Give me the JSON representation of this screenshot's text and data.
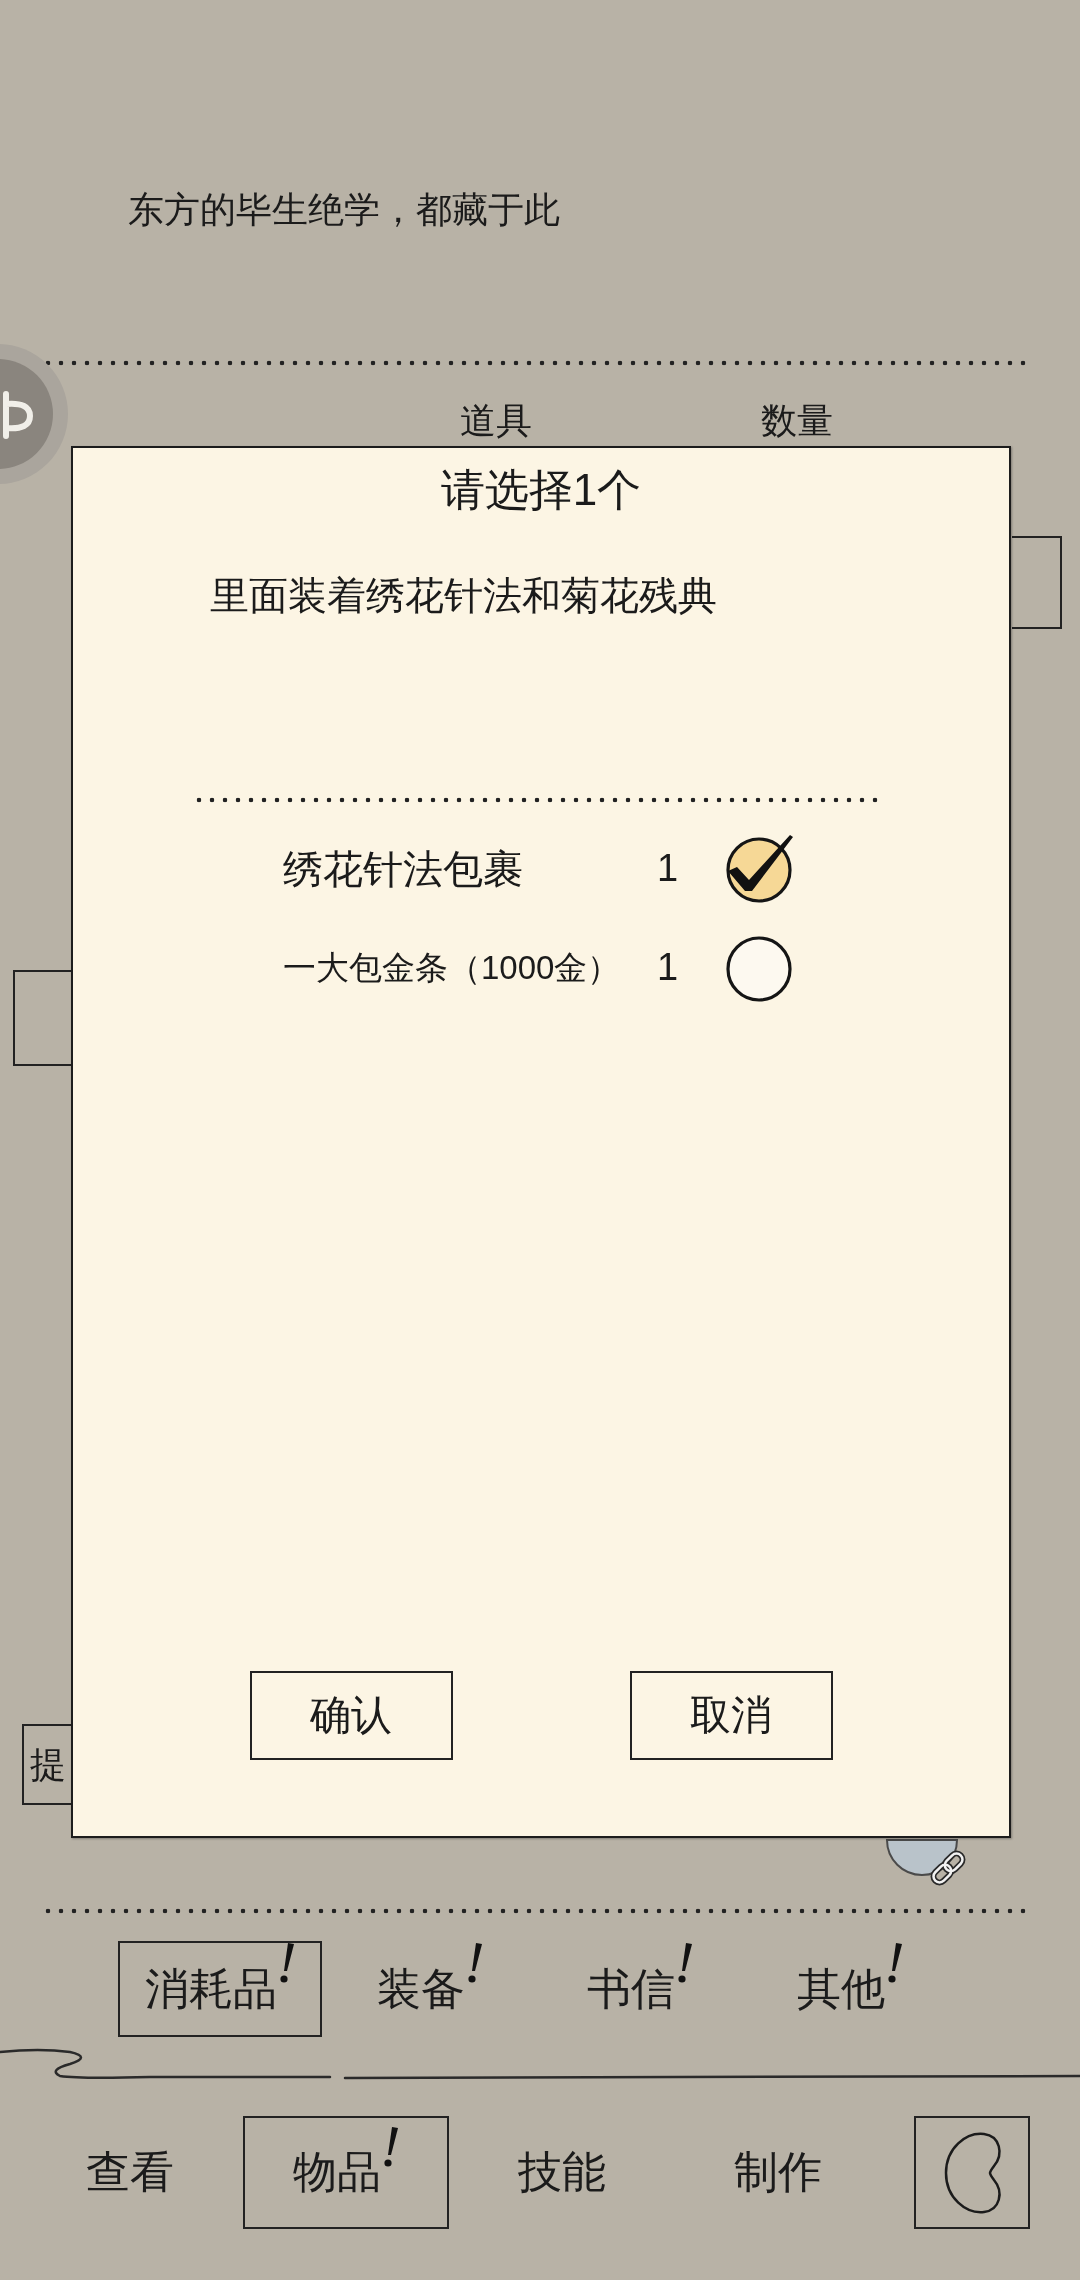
{
  "header": {
    "subtitle": "东方的毕生绝学，都藏于此"
  },
  "table": {
    "columns": [
      "道具",
      "数量"
    ]
  },
  "side_button": {
    "label": "提"
  },
  "dialog": {
    "title": "请选择1个",
    "description": "里面装着绣花针法和菊花残典",
    "options": [
      {
        "name": "绣花针法包裹",
        "count": "1",
        "selected": true
      },
      {
        "name": "一大包金条（1000金）",
        "count": "1",
        "selected": false
      }
    ],
    "buttons": [
      "确认",
      "取消"
    ]
  },
  "sub_tabs": [
    {
      "label": "消耗品",
      "selected": true,
      "alert": true
    },
    {
      "label": "装备",
      "selected": false,
      "alert": true
    },
    {
      "label": "书信",
      "selected": false,
      "alert": true
    },
    {
      "label": "其他",
      "selected": false,
      "alert": true
    }
  ],
  "nav": [
    {
      "label": "查看",
      "selected": false,
      "alert": false
    },
    {
      "label": "物品",
      "selected": true,
      "alert": true
    },
    {
      "label": "技能",
      "selected": false,
      "alert": false
    },
    {
      "label": "制作",
      "selected": false,
      "alert": false
    }
  ]
}
